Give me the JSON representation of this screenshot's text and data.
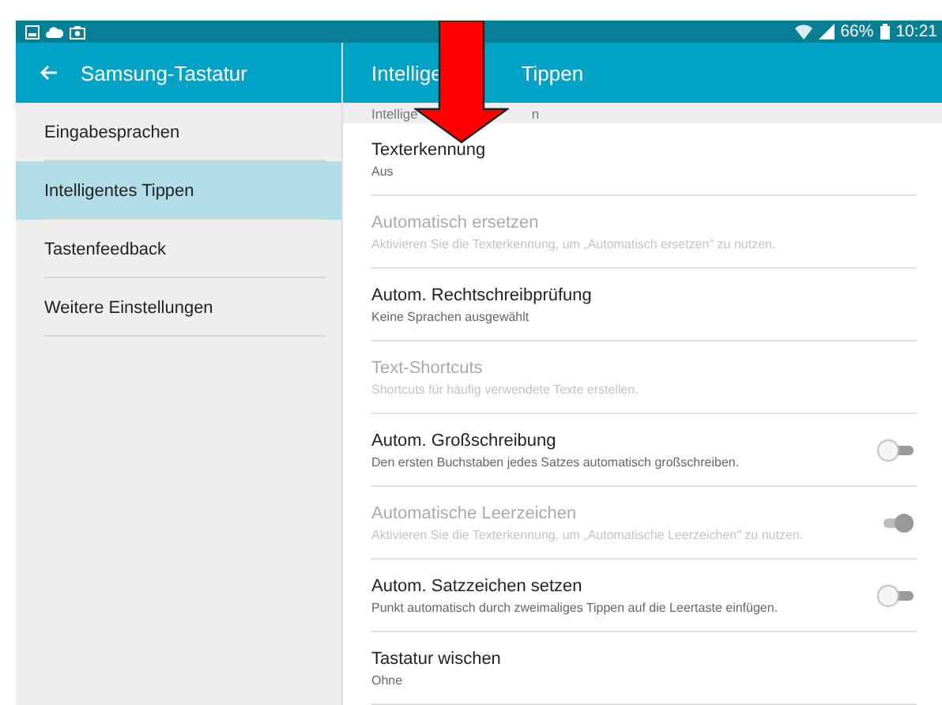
{
  "status_bar": {
    "battery": "66%",
    "time": "10:21"
  },
  "sidebar": {
    "title": "Samsung-Tastatur",
    "items": [
      {
        "label": "Eingabesprachen",
        "selected": false
      },
      {
        "label": "Intelligentes Tippen",
        "selected": true
      },
      {
        "label": "Tastenfeedback",
        "selected": false
      },
      {
        "label": "Weitere Einstellungen",
        "selected": false
      }
    ]
  },
  "content": {
    "title_parts": [
      "Intellige",
      "Tippen"
    ],
    "section_parts": [
      "Intellige",
      "n"
    ],
    "settings": [
      {
        "title": "Texterkennung",
        "summary": "Aus",
        "disabled": false,
        "kind": "plain"
      },
      {
        "title": "Automatisch ersetzen",
        "summary": "Aktivieren Sie die Texterkennung, um „Automatisch ersetzen\" zu nutzen.",
        "disabled": true,
        "kind": "plain"
      },
      {
        "title": "Autom. Rechtschreibprüfung",
        "summary": "Keine Sprachen ausgewählt",
        "disabled": false,
        "kind": "plain"
      },
      {
        "title": "Text-Shortcuts",
        "summary": "Shortcuts für häufig verwendete Texte erstellen.",
        "disabled": true,
        "kind": "plain"
      },
      {
        "title": "Autom. Großschreibung",
        "summary": "Den ersten Buchstaben jedes Satzes automatisch großschreiben.",
        "disabled": false,
        "kind": "switch",
        "on": false
      },
      {
        "title": "Automatische Leerzeichen",
        "summary": "Aktivieren Sie die Texterkennung, um „Automatische Leerzeichen\" zu nutzen.",
        "disabled": true,
        "kind": "switch",
        "on": true
      },
      {
        "title": "Autom. Satzzeichen setzen",
        "summary": "Punkt automatisch durch zweimaliges Tippen auf die Leertaste einfügen.",
        "disabled": false,
        "kind": "switch",
        "on": false
      },
      {
        "title": "Tastatur wischen",
        "summary": "Ohne",
        "disabled": false,
        "kind": "plain"
      }
    ]
  }
}
